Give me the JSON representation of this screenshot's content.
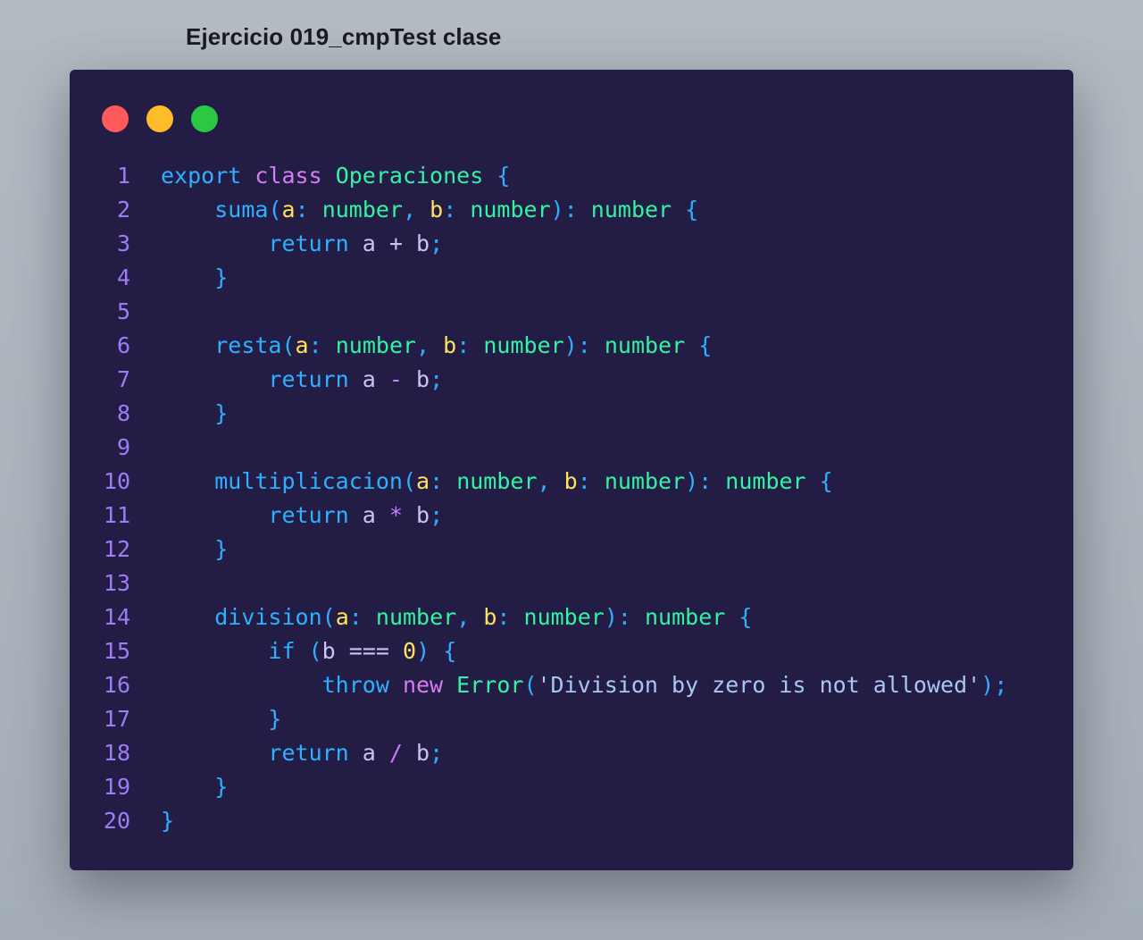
{
  "title": "Ejercicio 019_cmpTest clase",
  "window_controls": [
    {
      "name": "close-dot",
      "color": "#ff5a5a"
    },
    {
      "name": "minimize-dot",
      "color": "#ffbb2a"
    },
    {
      "name": "maximize-dot",
      "color": "#2dc843"
    }
  ],
  "code": {
    "lines": [
      {
        "number": "1",
        "indent": 0,
        "tokens": [
          {
            "t": "export",
            "k": "keyword"
          },
          {
            "t": " "
          },
          {
            "t": "class",
            "k": "class-keyword"
          },
          {
            "t": " "
          },
          {
            "t": "Operaciones",
            "k": "class-name"
          },
          {
            "t": " "
          },
          {
            "t": "{",
            "k": "punct"
          }
        ]
      },
      {
        "number": "2",
        "indent": 4,
        "tokens": [
          {
            "t": "suma",
            "k": "function"
          },
          {
            "t": "(",
            "k": "punct"
          },
          {
            "t": "a",
            "k": "param"
          },
          {
            "t": ":",
            "k": "punct"
          },
          {
            "t": " "
          },
          {
            "t": "number",
            "k": "type"
          },
          {
            "t": ",",
            "k": "punct"
          },
          {
            "t": " "
          },
          {
            "t": "b",
            "k": "param"
          },
          {
            "t": ":",
            "k": "punct"
          },
          {
            "t": " "
          },
          {
            "t": "number",
            "k": "type"
          },
          {
            "t": "):",
            "k": "punct"
          },
          {
            "t": " "
          },
          {
            "t": "number",
            "k": "type"
          },
          {
            "t": " "
          },
          {
            "t": "{",
            "k": "punct"
          }
        ]
      },
      {
        "number": "3",
        "indent": 8,
        "tokens": [
          {
            "t": "return",
            "k": "keyword"
          },
          {
            "t": " "
          },
          {
            "t": "a",
            "k": "var"
          },
          {
            "t": " "
          },
          {
            "t": "+",
            "k": "var"
          },
          {
            "t": " "
          },
          {
            "t": "b",
            "k": "var"
          },
          {
            "t": ";",
            "k": "punct"
          }
        ]
      },
      {
        "number": "4",
        "indent": 4,
        "tokens": [
          {
            "t": "}",
            "k": "punct"
          }
        ]
      },
      {
        "number": "5",
        "indent": 0,
        "tokens": []
      },
      {
        "number": "6",
        "indent": 4,
        "tokens": [
          {
            "t": "resta",
            "k": "function"
          },
          {
            "t": "(",
            "k": "punct"
          },
          {
            "t": "a",
            "k": "param"
          },
          {
            "t": ":",
            "k": "punct"
          },
          {
            "t": " "
          },
          {
            "t": "number",
            "k": "type"
          },
          {
            "t": ",",
            "k": "punct"
          },
          {
            "t": " "
          },
          {
            "t": "b",
            "k": "param"
          },
          {
            "t": ":",
            "k": "punct"
          },
          {
            "t": " "
          },
          {
            "t": "number",
            "k": "type"
          },
          {
            "t": "):",
            "k": "punct"
          },
          {
            "t": " "
          },
          {
            "t": "number",
            "k": "type"
          },
          {
            "t": " "
          },
          {
            "t": "{",
            "k": "punct"
          }
        ]
      },
      {
        "number": "7",
        "indent": 8,
        "tokens": [
          {
            "t": "return",
            "k": "keyword"
          },
          {
            "t": " "
          },
          {
            "t": "a",
            "k": "var"
          },
          {
            "t": " "
          },
          {
            "t": "-",
            "k": "op"
          },
          {
            "t": " "
          },
          {
            "t": "b",
            "k": "var"
          },
          {
            "t": ";",
            "k": "punct"
          }
        ]
      },
      {
        "number": "8",
        "indent": 4,
        "tokens": [
          {
            "t": "}",
            "k": "punct"
          }
        ]
      },
      {
        "number": "9",
        "indent": 0,
        "tokens": []
      },
      {
        "number": "10",
        "indent": 4,
        "tokens": [
          {
            "t": "multiplicacion",
            "k": "function"
          },
          {
            "t": "(",
            "k": "punct"
          },
          {
            "t": "a",
            "k": "param"
          },
          {
            "t": ":",
            "k": "punct"
          },
          {
            "t": " "
          },
          {
            "t": "number",
            "k": "type"
          },
          {
            "t": ",",
            "k": "punct"
          },
          {
            "t": " "
          },
          {
            "t": "b",
            "k": "param"
          },
          {
            "t": ":",
            "k": "punct"
          },
          {
            "t": " "
          },
          {
            "t": "number",
            "k": "type"
          },
          {
            "t": "):",
            "k": "punct"
          },
          {
            "t": " "
          },
          {
            "t": "number",
            "k": "type"
          },
          {
            "t": " "
          },
          {
            "t": "{",
            "k": "punct"
          }
        ]
      },
      {
        "number": "11",
        "indent": 8,
        "tokens": [
          {
            "t": "return",
            "k": "keyword"
          },
          {
            "t": " "
          },
          {
            "t": "a",
            "k": "var"
          },
          {
            "t": " "
          },
          {
            "t": "*",
            "k": "op"
          },
          {
            "t": " "
          },
          {
            "t": "b",
            "k": "var"
          },
          {
            "t": ";",
            "k": "punct"
          }
        ]
      },
      {
        "number": "12",
        "indent": 4,
        "tokens": [
          {
            "t": "}",
            "k": "punct"
          }
        ]
      },
      {
        "number": "13",
        "indent": 0,
        "tokens": []
      },
      {
        "number": "14",
        "indent": 4,
        "tokens": [
          {
            "t": "division",
            "k": "function"
          },
          {
            "t": "(",
            "k": "punct"
          },
          {
            "t": "a",
            "k": "param"
          },
          {
            "t": ":",
            "k": "punct"
          },
          {
            "t": " "
          },
          {
            "t": "number",
            "k": "type"
          },
          {
            "t": ",",
            "k": "punct"
          },
          {
            "t": " "
          },
          {
            "t": "b",
            "k": "param"
          },
          {
            "t": ":",
            "k": "punct"
          },
          {
            "t": " "
          },
          {
            "t": "number",
            "k": "type"
          },
          {
            "t": "):",
            "k": "punct"
          },
          {
            "t": " "
          },
          {
            "t": "number",
            "k": "type"
          },
          {
            "t": " "
          },
          {
            "t": "{",
            "k": "punct"
          }
        ]
      },
      {
        "number": "15",
        "indent": 8,
        "tokens": [
          {
            "t": "if",
            "k": "keyword"
          },
          {
            "t": " "
          },
          {
            "t": "(",
            "k": "punct"
          },
          {
            "t": "b",
            "k": "var"
          },
          {
            "t": " "
          },
          {
            "t": "===",
            "k": "var"
          },
          {
            "t": " "
          },
          {
            "t": "0",
            "k": "number"
          },
          {
            "t": ")",
            "k": "punct"
          },
          {
            "t": " "
          },
          {
            "t": "{",
            "k": "punct"
          }
        ]
      },
      {
        "number": "16",
        "indent": 12,
        "tokens": [
          {
            "t": "throw",
            "k": "keyword"
          },
          {
            "t": " "
          },
          {
            "t": "new",
            "k": "class-keyword"
          },
          {
            "t": " "
          },
          {
            "t": "Error",
            "k": "class-name"
          },
          {
            "t": "(",
            "k": "punct"
          },
          {
            "t": "'Division by zero is not allowed'",
            "k": "string"
          },
          {
            "t": ");",
            "k": "punct"
          }
        ]
      },
      {
        "number": "17",
        "indent": 8,
        "tokens": [
          {
            "t": "}",
            "k": "punct"
          }
        ]
      },
      {
        "number": "18",
        "indent": 8,
        "tokens": [
          {
            "t": "return",
            "k": "keyword"
          },
          {
            "t": " "
          },
          {
            "t": "a",
            "k": "var"
          },
          {
            "t": " "
          },
          {
            "t": "/",
            "k": "op"
          },
          {
            "t": " "
          },
          {
            "t": "b",
            "k": "var"
          },
          {
            "t": ";",
            "k": "punct"
          }
        ]
      },
      {
        "number": "19",
        "indent": 4,
        "tokens": [
          {
            "t": "}",
            "k": "punct"
          }
        ]
      },
      {
        "number": "20",
        "indent": 0,
        "tokens": [
          {
            "t": "}",
            "k": "punct"
          }
        ]
      }
    ]
  }
}
